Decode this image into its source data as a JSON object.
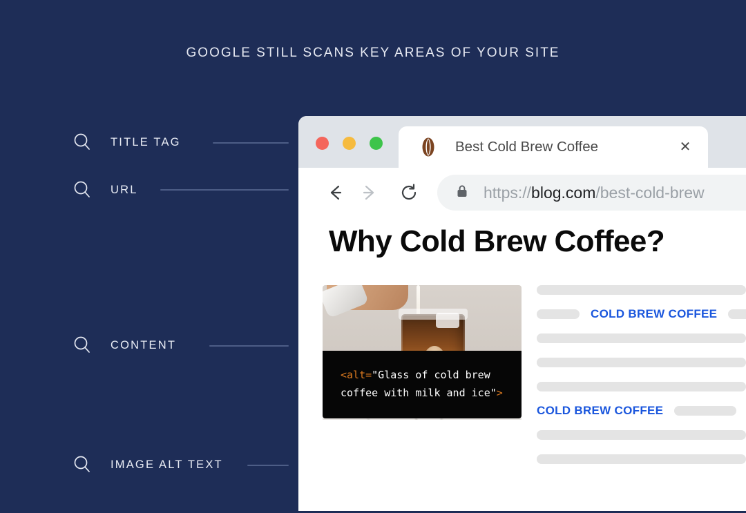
{
  "page": {
    "title": "GOOGLE STILL SCANS KEY AREAS OF YOUR SITE",
    "background_color": "#1e2d57"
  },
  "checklist": {
    "items": [
      {
        "label": "TITLE TAG",
        "icon": "search-icon"
      },
      {
        "label": "URL",
        "icon": "search-icon"
      },
      {
        "label": "CONTENT",
        "icon": "search-icon"
      },
      {
        "label": "IMAGE ALT TEXT",
        "icon": "search-icon"
      }
    ]
  },
  "browser": {
    "traffic_lights": [
      {
        "name": "close",
        "color": "#f4665c"
      },
      {
        "name": "minimize",
        "color": "#f6bb3f"
      },
      {
        "name": "maximize",
        "color": "#3dc44a"
      }
    ],
    "tab": {
      "title": "Best Cold Brew Coffee",
      "favicon": "coffee-bean-icon",
      "close_label": "✕"
    },
    "nav": {
      "back": "back-arrow-icon",
      "forward": "forward-arrow-icon",
      "reload": "reload-icon"
    },
    "omnibox": {
      "lock": "lock-icon",
      "scheme": "https://",
      "host": "blog.com",
      "path": "/best-cold-brew"
    }
  },
  "article": {
    "heading": "Why Cold Brew Coffee?",
    "image": {
      "name": "cold-brew-photo",
      "alt_code_prefix": "<alt=",
      "alt_code_value": "\"Glass of cold brew coffee with milk and ice\"",
      "alt_code_suffix": ">"
    },
    "body_rows": [
      {
        "type": "bar",
        "widths": [
          283
        ]
      },
      {
        "type": "mixed",
        "leading_bar": 62,
        "link": "COLD BREW COFFEE",
        "trailing_bar": 40
      },
      {
        "type": "bar",
        "widths": [
          283
        ]
      },
      {
        "type": "bar",
        "widths": [
          283
        ]
      },
      {
        "type": "bar",
        "widths": [
          283
        ]
      },
      {
        "type": "link-first",
        "link": "COLD BREW COFFEE",
        "trailing_bar": 90
      },
      {
        "type": "bar",
        "widths": [
          283
        ]
      },
      {
        "type": "bar",
        "widths": [
          283
        ]
      }
    ],
    "link_color": "#1a56dd"
  }
}
